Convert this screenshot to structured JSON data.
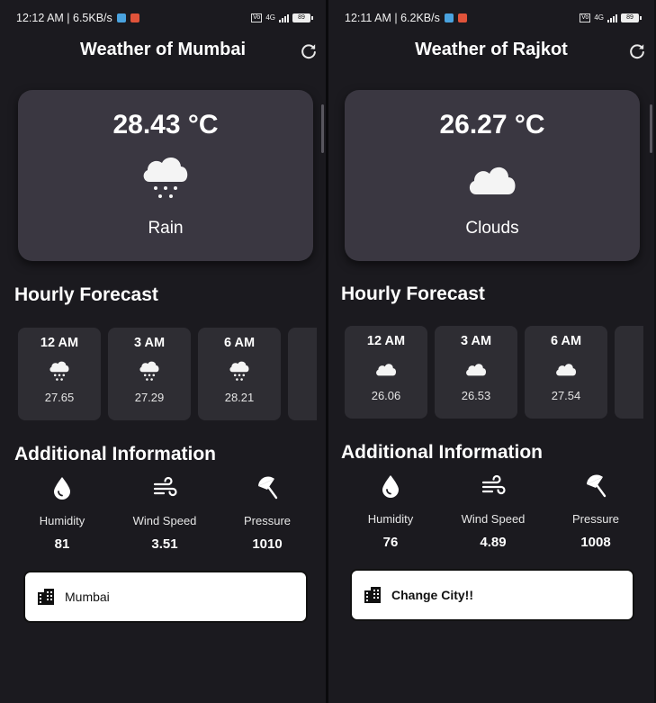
{
  "screens": [
    {
      "status": {
        "time": "12:12 AM | 6.5KB/s",
        "network": "4G",
        "battery": "89"
      },
      "title": "Weather of Mumbai",
      "current": {
        "temp": "28.43 °C",
        "condition": "Rain",
        "icon": "rain-cloud-icon"
      },
      "hourly_title": "Hourly Forecast",
      "hourly": [
        {
          "time": "12 AM",
          "temp": "27.65",
          "icon": "rain-cloud-icon"
        },
        {
          "time": "3 AM",
          "temp": "27.29",
          "icon": "rain-cloud-icon"
        },
        {
          "time": "6 AM",
          "temp": "28.21",
          "icon": "rain-cloud-icon"
        }
      ],
      "info_title": "Additional Information",
      "info": [
        {
          "label": "Humidity",
          "value": "81",
          "icon": "water-drop-icon"
        },
        {
          "label": "Wind Speed",
          "value": "3.51",
          "icon": "wind-icon"
        },
        {
          "label": "Pressure",
          "value": "1010",
          "icon": "beach-umbrella-icon"
        }
      ],
      "city_input": {
        "value": "Mumbai",
        "placeholder": ""
      }
    },
    {
      "status": {
        "time": "12:11 AM | 6.2KB/s",
        "network": "4G",
        "battery": "89"
      },
      "title": "Weather of Rajkot",
      "current": {
        "temp": "26.27 °C",
        "condition": "Clouds",
        "icon": "cloud-icon"
      },
      "hourly_title": "Hourly Forecast",
      "hourly": [
        {
          "time": "12 AM",
          "temp": "26.06",
          "icon": "cloud-icon"
        },
        {
          "time": "3 AM",
          "temp": "26.53",
          "icon": "cloud-icon"
        },
        {
          "time": "6 AM",
          "temp": "27.54",
          "icon": "cloud-icon"
        }
      ],
      "info_title": "Additional Information",
      "info": [
        {
          "label": "Humidity",
          "value": "76",
          "icon": "water-drop-icon"
        },
        {
          "label": "Wind Speed",
          "value": "4.89",
          "icon": "wind-icon"
        },
        {
          "label": "Pressure",
          "value": "1008",
          "icon": "beach-umbrella-icon"
        }
      ],
      "city_input": {
        "value": "",
        "placeholder": "Change City!!"
      }
    }
  ],
  "colors": {
    "background": "#1b1a1f",
    "card": "#3a3741",
    "hour_card": "#2e2d33",
    "text": "#ffffff",
    "input_bg": "#ffffff"
  }
}
